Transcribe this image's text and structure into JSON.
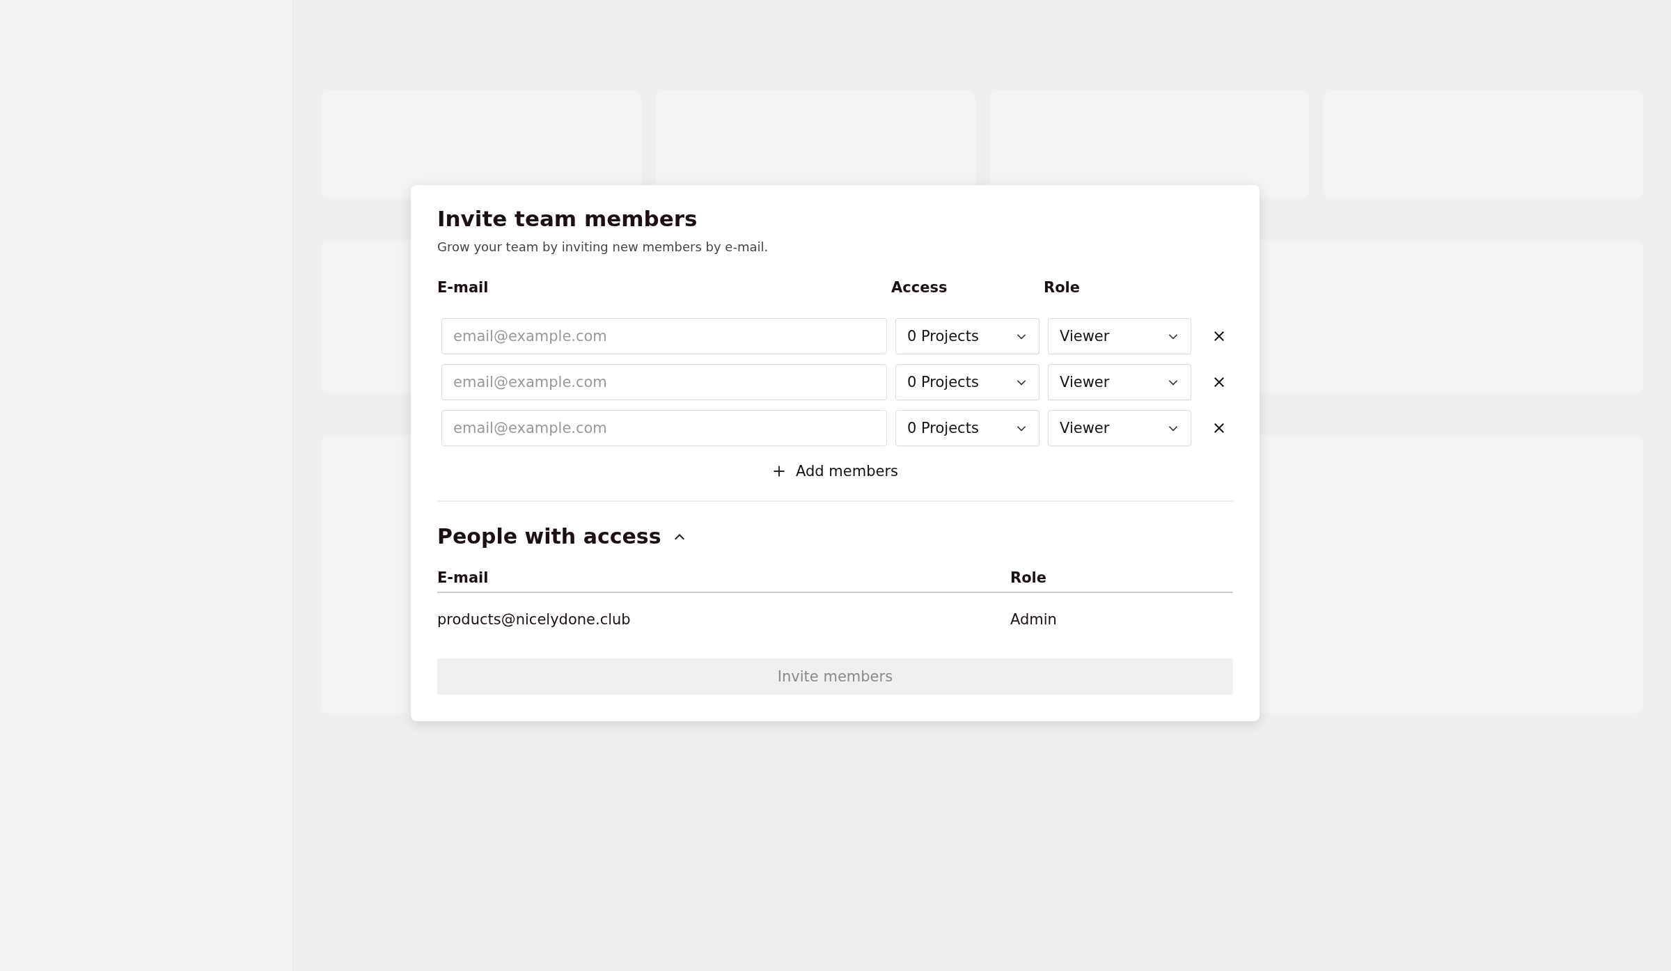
{
  "dialog": {
    "title": "Invite team members",
    "subtitle": "Grow your team by inviting new members by e-mail.",
    "invite_columns": [
      "E-mail",
      "Access",
      "Role"
    ],
    "invite_rows": [
      {
        "email_placeholder": "email@example.com",
        "access": "0 Projects",
        "role": "Viewer"
      },
      {
        "email_placeholder": "email@example.com",
        "access": "0 Projects",
        "role": "Viewer"
      },
      {
        "email_placeholder": "email@example.com",
        "access": "0 Projects",
        "role": "Viewer"
      }
    ],
    "add_button": "Add members",
    "people_section": {
      "title": "People with access",
      "expanded": true,
      "columns": [
        "E-mail",
        "Role"
      ],
      "rows": [
        {
          "email": "products@nicelydone.club",
          "role": "Admin"
        }
      ]
    },
    "submit_button": {
      "label": "Invite members",
      "disabled": true
    }
  }
}
